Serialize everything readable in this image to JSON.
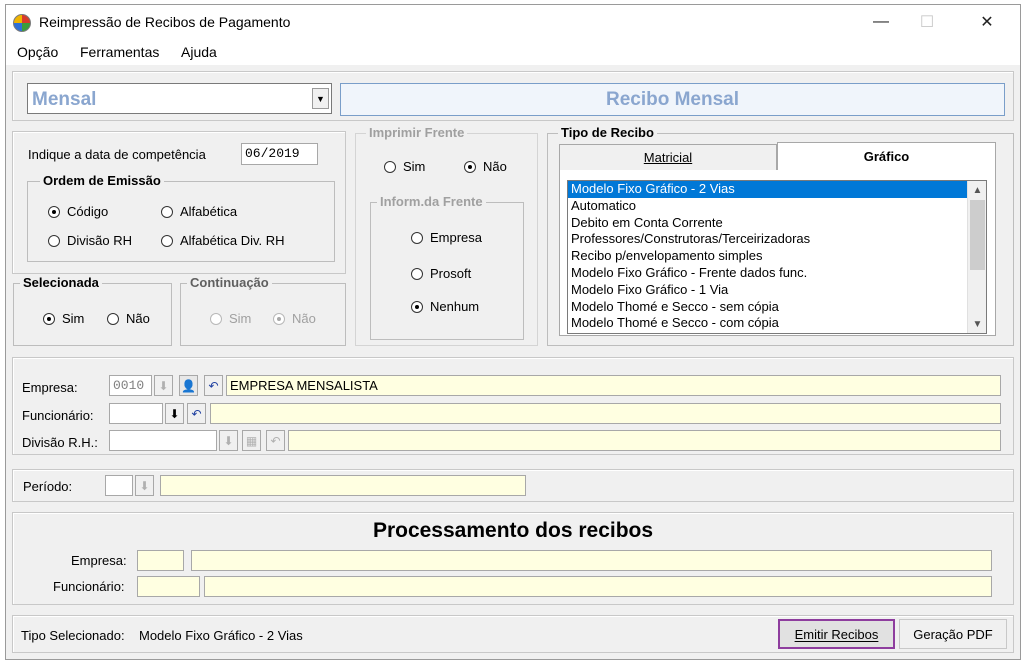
{
  "window": {
    "title": "Reimpressão de Recibos de Pagamento",
    "minimize": "—",
    "maximize": "☐",
    "close": "✕"
  },
  "menu": [
    "Opção",
    "Ferramentas",
    "Ajuda"
  ],
  "top": {
    "type_select": "Mensal",
    "receipt_title": "Recibo Mensal"
  },
  "competencia": {
    "label": "Indique a data de competência",
    "value": "06/2019"
  },
  "ordem": {
    "legend": "Ordem de Emissão",
    "options": [
      "Código",
      "Alfabética",
      "Divisão RH",
      "Alfabética Div.  RH"
    ],
    "selected": "Código"
  },
  "selecionada": {
    "legend": "Selecionada",
    "sim": "Sim",
    "nao": "Não",
    "selected": "Sim"
  },
  "continuacao": {
    "legend": "Continuação",
    "sim": "Sim",
    "nao": "Não",
    "selected": "Não"
  },
  "imprimir_frente": {
    "legend": "Imprimir Frente",
    "sim": "Sim",
    "nao": "Não",
    "selected": "Não"
  },
  "inform_frente": {
    "legend": "Inform.da Frente",
    "options": [
      "Empresa",
      "Prosoft",
      "Nenhum"
    ],
    "selected": "Nenhum"
  },
  "tipo_recibo": {
    "legend": "Tipo de Recibo",
    "tabs": [
      "Matricial",
      "Gráfico"
    ],
    "active_tab": "Gráfico",
    "items": [
      "Modelo Fixo Gráfico - 2 Vias",
      "Automatico",
      "Debito em Conta Corrente",
      "Professores/Construtoras/Terceirizadoras",
      "Recibo p/envelopamento simples",
      "Modelo Fixo Gráfico - Frente dados func.",
      "Modelo Fixo Gráfico - 1 Via",
      "Modelo Thomé e Secco - sem cópia",
      "Modelo Thomé e Secco - com cópia"
    ],
    "selected_index": 0
  },
  "filtros": {
    "empresa_label": "Empresa:",
    "empresa_code": "0010",
    "empresa_name": "EMPRESA MENSALISTA",
    "funcionario_label": "Funcionário:",
    "funcionario_code": "",
    "funcionario_name": "",
    "divisao_label": "Divisão R.H.:",
    "divisao_code": "",
    "divisao_name": ""
  },
  "periodo": {
    "label": "Período:",
    "code": "",
    "name": ""
  },
  "processamento": {
    "title": "Processamento dos recibos",
    "empresa_label": "Empresa:",
    "funcionario_label": "Funcionário:"
  },
  "status": {
    "label": "Tipo Selecionado:",
    "value": "Modelo Fixo Gráfico - 2 Vias"
  },
  "buttons": {
    "emitir": "Emitir Recibos",
    "pdf": "Geração PDF"
  },
  "colors": {
    "accent": "#0078d7",
    "highlight_border": "#8e3d9e",
    "yellow_field": "#ffffe1"
  }
}
